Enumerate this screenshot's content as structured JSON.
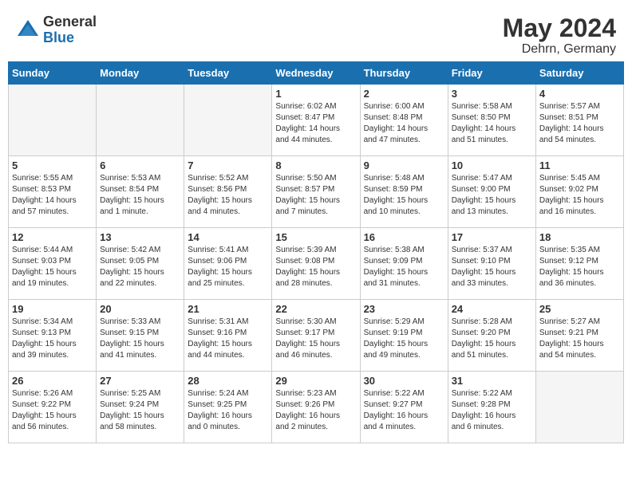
{
  "logo": {
    "general": "General",
    "blue": "Blue"
  },
  "title": {
    "month_year": "May 2024",
    "location": "Dehrn, Germany"
  },
  "weekdays": [
    "Sunday",
    "Monday",
    "Tuesday",
    "Wednesday",
    "Thursday",
    "Friday",
    "Saturday"
  ],
  "weeks": [
    [
      {
        "day": "",
        "content": ""
      },
      {
        "day": "",
        "content": ""
      },
      {
        "day": "",
        "content": ""
      },
      {
        "day": "1",
        "content": "Sunrise: 6:02 AM\nSunset: 8:47 PM\nDaylight: 14 hours\nand 44 minutes."
      },
      {
        "day": "2",
        "content": "Sunrise: 6:00 AM\nSunset: 8:48 PM\nDaylight: 14 hours\nand 47 minutes."
      },
      {
        "day": "3",
        "content": "Sunrise: 5:58 AM\nSunset: 8:50 PM\nDaylight: 14 hours\nand 51 minutes."
      },
      {
        "day": "4",
        "content": "Sunrise: 5:57 AM\nSunset: 8:51 PM\nDaylight: 14 hours\nand 54 minutes."
      }
    ],
    [
      {
        "day": "5",
        "content": "Sunrise: 5:55 AM\nSunset: 8:53 PM\nDaylight: 14 hours\nand 57 minutes."
      },
      {
        "day": "6",
        "content": "Sunrise: 5:53 AM\nSunset: 8:54 PM\nDaylight: 15 hours\nand 1 minute."
      },
      {
        "day": "7",
        "content": "Sunrise: 5:52 AM\nSunset: 8:56 PM\nDaylight: 15 hours\nand 4 minutes."
      },
      {
        "day": "8",
        "content": "Sunrise: 5:50 AM\nSunset: 8:57 PM\nDaylight: 15 hours\nand 7 minutes."
      },
      {
        "day": "9",
        "content": "Sunrise: 5:48 AM\nSunset: 8:59 PM\nDaylight: 15 hours\nand 10 minutes."
      },
      {
        "day": "10",
        "content": "Sunrise: 5:47 AM\nSunset: 9:00 PM\nDaylight: 15 hours\nand 13 minutes."
      },
      {
        "day": "11",
        "content": "Sunrise: 5:45 AM\nSunset: 9:02 PM\nDaylight: 15 hours\nand 16 minutes."
      }
    ],
    [
      {
        "day": "12",
        "content": "Sunrise: 5:44 AM\nSunset: 9:03 PM\nDaylight: 15 hours\nand 19 minutes."
      },
      {
        "day": "13",
        "content": "Sunrise: 5:42 AM\nSunset: 9:05 PM\nDaylight: 15 hours\nand 22 minutes."
      },
      {
        "day": "14",
        "content": "Sunrise: 5:41 AM\nSunset: 9:06 PM\nDaylight: 15 hours\nand 25 minutes."
      },
      {
        "day": "15",
        "content": "Sunrise: 5:39 AM\nSunset: 9:08 PM\nDaylight: 15 hours\nand 28 minutes."
      },
      {
        "day": "16",
        "content": "Sunrise: 5:38 AM\nSunset: 9:09 PM\nDaylight: 15 hours\nand 31 minutes."
      },
      {
        "day": "17",
        "content": "Sunrise: 5:37 AM\nSunset: 9:10 PM\nDaylight: 15 hours\nand 33 minutes."
      },
      {
        "day": "18",
        "content": "Sunrise: 5:35 AM\nSunset: 9:12 PM\nDaylight: 15 hours\nand 36 minutes."
      }
    ],
    [
      {
        "day": "19",
        "content": "Sunrise: 5:34 AM\nSunset: 9:13 PM\nDaylight: 15 hours\nand 39 minutes."
      },
      {
        "day": "20",
        "content": "Sunrise: 5:33 AM\nSunset: 9:15 PM\nDaylight: 15 hours\nand 41 minutes."
      },
      {
        "day": "21",
        "content": "Sunrise: 5:31 AM\nSunset: 9:16 PM\nDaylight: 15 hours\nand 44 minutes."
      },
      {
        "day": "22",
        "content": "Sunrise: 5:30 AM\nSunset: 9:17 PM\nDaylight: 15 hours\nand 46 minutes."
      },
      {
        "day": "23",
        "content": "Sunrise: 5:29 AM\nSunset: 9:19 PM\nDaylight: 15 hours\nand 49 minutes."
      },
      {
        "day": "24",
        "content": "Sunrise: 5:28 AM\nSunset: 9:20 PM\nDaylight: 15 hours\nand 51 minutes."
      },
      {
        "day": "25",
        "content": "Sunrise: 5:27 AM\nSunset: 9:21 PM\nDaylight: 15 hours\nand 54 minutes."
      }
    ],
    [
      {
        "day": "26",
        "content": "Sunrise: 5:26 AM\nSunset: 9:22 PM\nDaylight: 15 hours\nand 56 minutes."
      },
      {
        "day": "27",
        "content": "Sunrise: 5:25 AM\nSunset: 9:24 PM\nDaylight: 15 hours\nand 58 minutes."
      },
      {
        "day": "28",
        "content": "Sunrise: 5:24 AM\nSunset: 9:25 PM\nDaylight: 16 hours\nand 0 minutes."
      },
      {
        "day": "29",
        "content": "Sunrise: 5:23 AM\nSunset: 9:26 PM\nDaylight: 16 hours\nand 2 minutes."
      },
      {
        "day": "30",
        "content": "Sunrise: 5:22 AM\nSunset: 9:27 PM\nDaylight: 16 hours\nand 4 minutes."
      },
      {
        "day": "31",
        "content": "Sunrise: 5:22 AM\nSunset: 9:28 PM\nDaylight: 16 hours\nand 6 minutes."
      },
      {
        "day": "",
        "content": ""
      }
    ]
  ]
}
